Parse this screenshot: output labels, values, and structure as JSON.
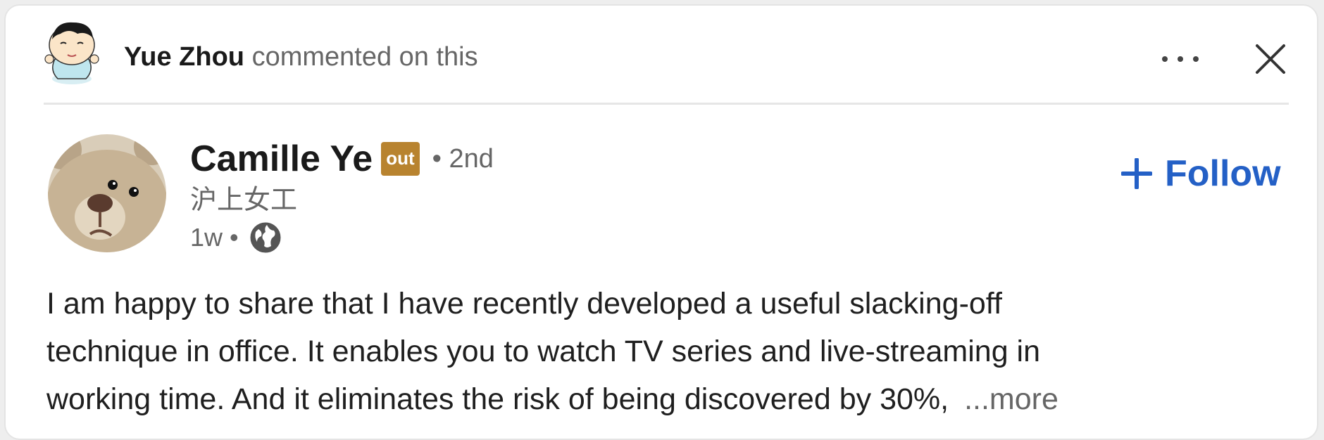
{
  "header": {
    "actor_name": "Yue Zhou",
    "action_text": "commented on this",
    "actor_avatar_icon": "cartoon-boy-avatar",
    "more_icon": "ellipsis-icon",
    "close_icon": "close-icon"
  },
  "post": {
    "author": {
      "name": "Camille Ye",
      "badge": "out",
      "badge_color": "#b8832f",
      "degree": "• 2nd",
      "headline": "沪上女工",
      "time": "1w",
      "separator": "•",
      "visibility_icon": "globe-icon",
      "avatar_icon": "teddy-bear-avatar"
    },
    "follow": {
      "label": "Follow",
      "icon": "plus-icon",
      "color": "#2460c6"
    },
    "body_lines": [
      "I am happy to share that I have recently developed a useful slacking-off",
      "technique in office. It enables you to watch TV series and live-streaming in",
      "working time. And it eliminates the risk of being discovered by 30%,"
    ],
    "see_more": "...more"
  }
}
